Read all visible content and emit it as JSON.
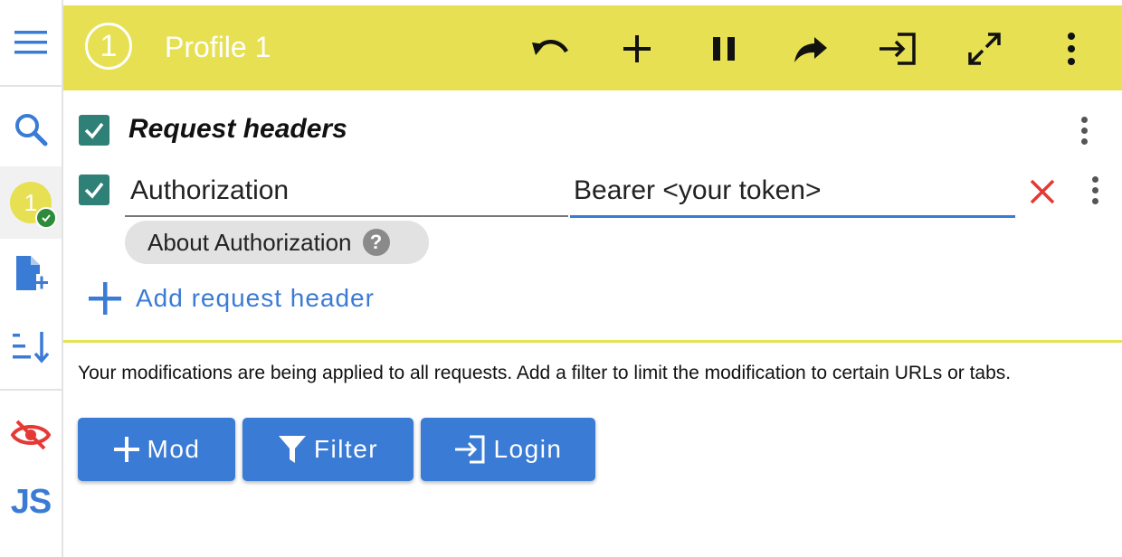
{
  "sidebar": {
    "items": [
      {
        "name": "menu-icon"
      },
      {
        "name": "search-icon"
      },
      {
        "name": "profile-1-icon",
        "label": "1",
        "active": true
      },
      {
        "name": "add-file-icon"
      },
      {
        "name": "sort-icon"
      },
      {
        "name": "eye-off-icon"
      },
      {
        "name": "js-icon",
        "label": "JS"
      }
    ]
  },
  "header": {
    "profile_number": "1",
    "title": "Profile 1",
    "color": "#e6e052",
    "actions": [
      "undo-icon",
      "add-icon",
      "pause-icon",
      "redo-share-icon",
      "login-icon",
      "expand-icon",
      "more-vert-icon"
    ]
  },
  "section": {
    "title": "Request headers",
    "checked": true
  },
  "header_row": {
    "checked": true,
    "name": "Authorization",
    "value": "Bearer <your token>",
    "help_chip": "About Authorization",
    "help_glyph": "?"
  },
  "add_header_label": "Add request header",
  "notice": "Your modifications are being applied to all requests. Add a filter to limit the modification to certain URLs or tabs.",
  "buttons": {
    "mod": "Mod",
    "filter": "Filter",
    "login": "Login"
  },
  "colors": {
    "accent": "#3a7bd5",
    "checkbox": "#2f8077",
    "delete": "#e53935",
    "profile": "#e6e052"
  }
}
